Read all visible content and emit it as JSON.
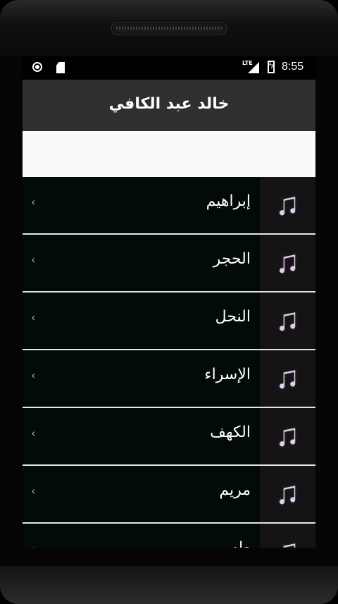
{
  "status_bar": {
    "network": "LTE",
    "time": "8:55"
  },
  "app_bar": {
    "title": "خالد عبد الكافي"
  },
  "list": {
    "items": [
      {
        "label": "إبراهيم"
      },
      {
        "label": "الحجر"
      },
      {
        "label": "النحل"
      },
      {
        "label": "الإسراء"
      },
      {
        "label": "الكهف"
      },
      {
        "label": "مريم"
      },
      {
        "label": "طه"
      }
    ],
    "item_icon": "music-note-icon",
    "chevron_glyph": "‹"
  },
  "colors": {
    "app_bar": "#2f2f2f",
    "list_bg": "#020b05",
    "icon_cell": "#141414",
    "note_fill": "#e7c9f1",
    "note_stroke": "#1a1a1a",
    "divider": "#e6e6e6"
  }
}
